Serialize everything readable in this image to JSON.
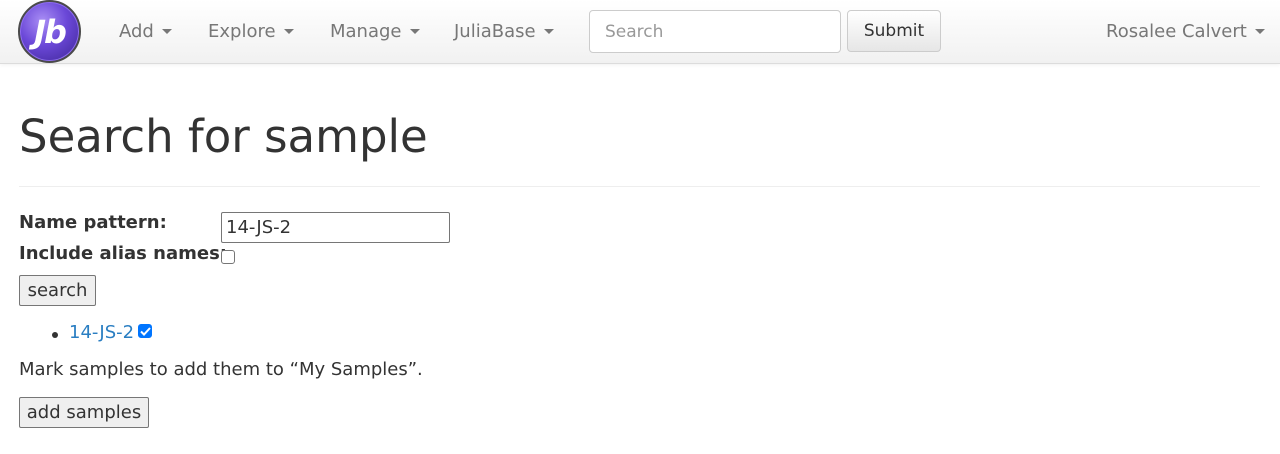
{
  "navbar": {
    "logo_text": "Jb",
    "menus": [
      {
        "label": "Add"
      },
      {
        "label": "Explore"
      },
      {
        "label": "Manage"
      },
      {
        "label": "JuliaBase"
      }
    ],
    "search": {
      "placeholder": "Search",
      "value": ""
    },
    "submit_label": "Submit",
    "user_name": "Rosalee Calvert"
  },
  "main": {
    "title": "Search for sample",
    "name_pattern_label": "Name pattern:",
    "name_pattern_value": "14-JS-2",
    "alias_label": "Include alias names:",
    "alias_checked": false,
    "search_button": "search",
    "results": [
      {
        "name": "14-JS-2",
        "checked": true
      }
    ],
    "hint": "Mark samples to add them to “My Samples”.",
    "add_button": "add samples"
  },
  "colors": {
    "link": "#2a7ec2",
    "checkbox_accent": "#0075ff",
    "logo_purple": "#6b48d8"
  }
}
